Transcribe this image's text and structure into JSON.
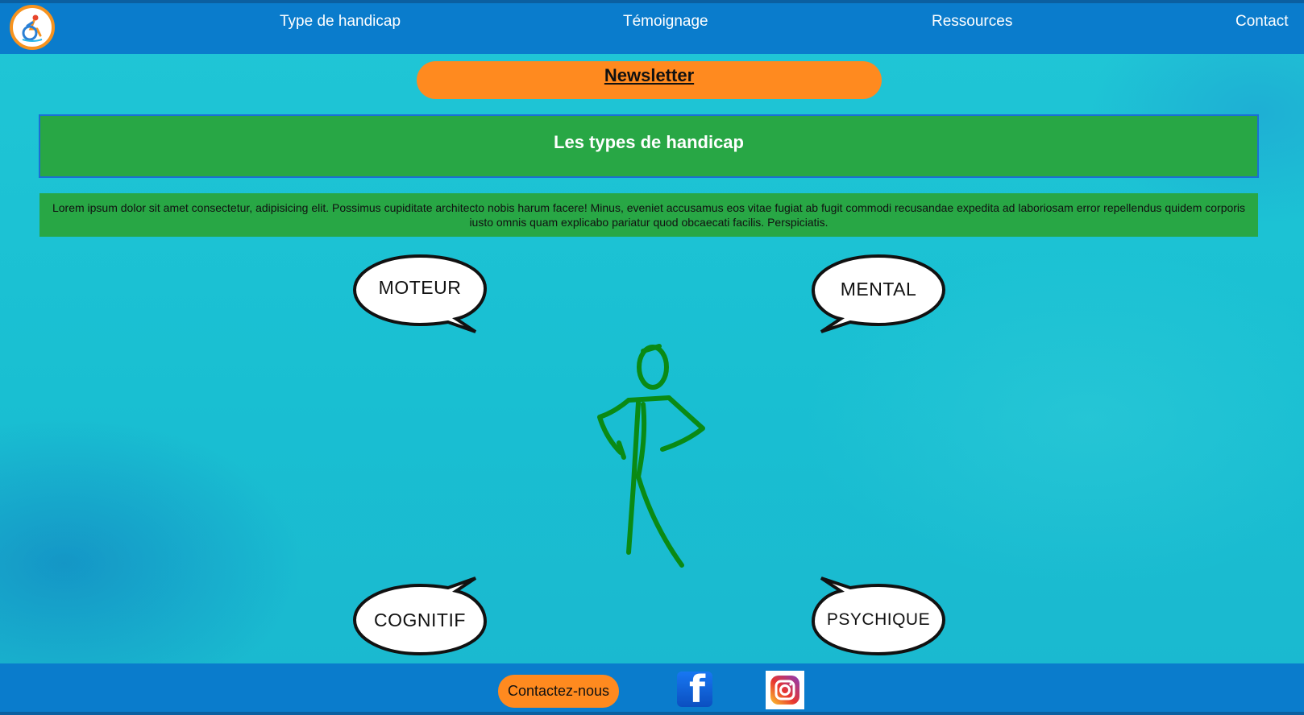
{
  "nav": {
    "items": [
      "Type de handicap",
      "Témoignage",
      "Ressources",
      "Contact"
    ]
  },
  "newsletter": {
    "label": "Newsletter"
  },
  "main": {
    "title": "Les types de handicap",
    "intro": "Lorem ipsum dolor sit amet consectetur, adipisicing elit. Possimus cupiditate architecto nobis harum facere! Minus, eveniet accusamus eos vitae fugiat ab fugit commodi recusandae expedita ad laboriosam error repellendus quidem corporis iusto omnis quam explicabo pariatur quod obcaecati facilis. Perspiciatis.",
    "bubbles": [
      "MOTEUR",
      "MENTAL",
      "COGNITIF",
      "PSYCHIQUE"
    ]
  },
  "footer": {
    "contact_label": "Contactez-nous",
    "icons": [
      "facebook-icon",
      "instagram-icon"
    ]
  },
  "colors": {
    "header": "#0a7ccc",
    "accent": "#ff8a1f",
    "green": "#28a745",
    "figure": "#0a8a14"
  }
}
